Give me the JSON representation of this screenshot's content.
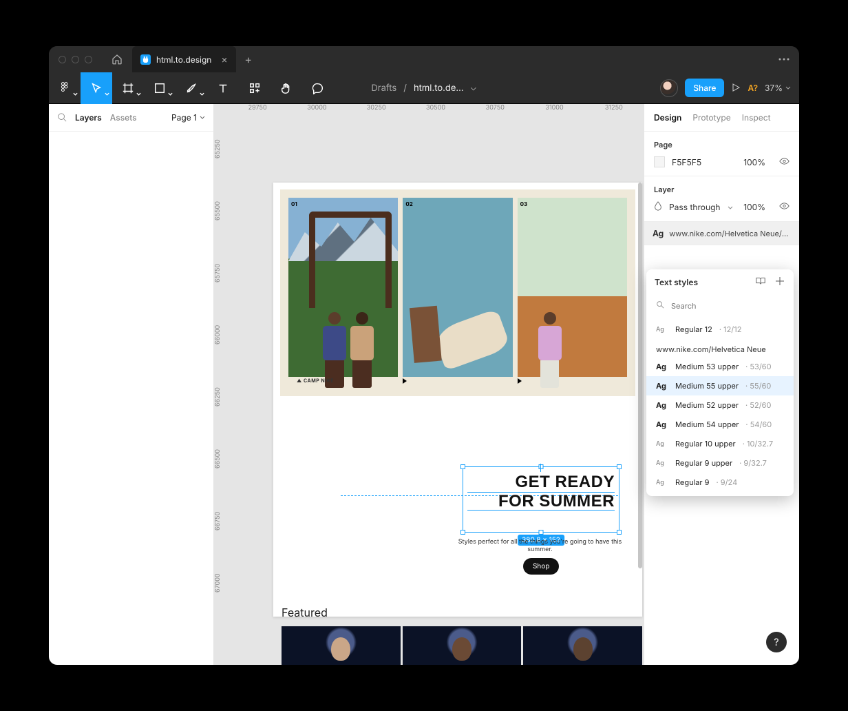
{
  "tabs": {
    "file_name": "html.to.design"
  },
  "breadcrumbs": {
    "folder": "Drafts",
    "sep": "/",
    "file": "html.to.de…"
  },
  "toolbar": {
    "share": "Share",
    "warn": "A?",
    "zoom": "37%"
  },
  "left_panel": {
    "layers": "Layers",
    "assets": "Assets",
    "page": "Page 1"
  },
  "ruler_h": [
    "29750",
    "30000",
    "30250",
    "30500",
    "30750",
    "31000",
    "31250"
  ],
  "ruler_v": [
    "65250",
    "65500",
    "65750",
    "66000",
    "66250",
    "66500",
    "66750",
    "67000"
  ],
  "artboard": {
    "cards": {
      "c1_num": "01",
      "c2_num": "02",
      "c3_num": "03",
      "caption1": "▲  CAMP NIKE"
    },
    "headline_l1": "GET READY",
    "headline_l2": "FOR SUMMER",
    "selection_dims": "380.8 × 152",
    "subhead": "Styles perfect for all the things you're going to have this summer.",
    "shop": "Shop",
    "featured": "Featured"
  },
  "right_panel": {
    "tabs": {
      "design": "Design",
      "prototype": "Prototype",
      "inspect": "Inspect"
    },
    "page_section": {
      "title": "Page",
      "hex": "F5F5F5",
      "opacity": "100%"
    },
    "layer_section": {
      "title": "Layer",
      "blend": "Pass through",
      "opacity": "100%"
    },
    "selected_style": "www.nike.com/Helvetica Neue/M…"
  },
  "popover": {
    "title": "Text styles",
    "search_placeholder": "Search",
    "items_top": [
      {
        "ag": "Ag",
        "ag_small": true,
        "name": "Regular 12",
        "meta": "· 12/12"
      }
    ],
    "group": "www.nike.com/Helvetica Neue",
    "items": [
      {
        "ag": "Ag",
        "name": "Medium 53 upper",
        "meta": "· 53/60",
        "sel": false
      },
      {
        "ag": "Ag",
        "name": "Medium 55 upper",
        "meta": "· 55/60",
        "sel": true
      },
      {
        "ag": "Ag",
        "name": "Medium 52 upper",
        "meta": "· 52/60",
        "sel": false
      },
      {
        "ag": "Ag",
        "name": "Medium 54 upper",
        "meta": "· 54/60",
        "sel": false
      },
      {
        "ag": "Ag",
        "ag_small": true,
        "name": "Regular 10 upper",
        "meta": "· 10/32.7",
        "sel": false
      },
      {
        "ag": "Ag",
        "ag_small": true,
        "name": "Regular 9 upper",
        "meta": "· 9/32.7",
        "sel": false
      },
      {
        "ag": "Ag",
        "ag_small": true,
        "name": "Regular 9",
        "meta": "· 9/24",
        "sel": false
      }
    ]
  },
  "help": "?"
}
